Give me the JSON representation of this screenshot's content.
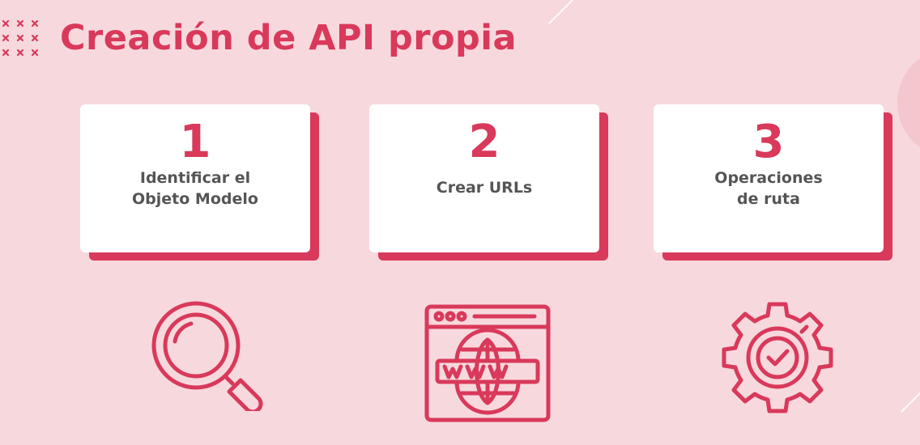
{
  "title": "Creación de API propia",
  "steps": [
    {
      "number": "1",
      "label": "Identificar el\nObjeto Modelo",
      "icon": "magnifying-glass-icon"
    },
    {
      "number": "2",
      "label": "Crear URLs",
      "icon": "web-browser-www-icon"
    },
    {
      "number": "3",
      "label": "Operaciones\nde ruta",
      "icon": "gear-check-icon"
    }
  ],
  "colors": {
    "accent": "#d9395a",
    "background": "#f7d9dd",
    "text": "#555555",
    "card": "#ffffff"
  }
}
